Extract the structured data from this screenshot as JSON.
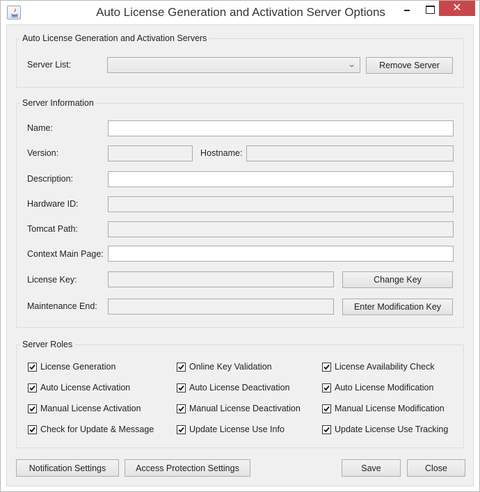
{
  "window": {
    "title": "Auto License Generation and Activation Server Options",
    "icon": "java-app-icon",
    "controls": {
      "minimize": "minimize-icon",
      "maximize": "maximize-icon",
      "close": "✕"
    }
  },
  "servers_group": {
    "legend": "Auto License Generation and Activation Servers",
    "server_list_label": "Server List:",
    "server_list_value": "",
    "remove_server_button": "Remove Server"
  },
  "server_info": {
    "legend": "Server Information",
    "name_label": "Name:",
    "name_value": "",
    "version_label": "Version:",
    "version_value": "",
    "hostname_label": "Hostname:",
    "hostname_value": "",
    "description_label": "Description:",
    "description_value": "",
    "hardware_id_label": "Hardware ID:",
    "hardware_id_value": "",
    "tomcat_path_label": "Tomcat Path:",
    "tomcat_path_value": "",
    "context_main_page_label": "Context Main Page:",
    "context_main_page_value": "",
    "license_key_label": "License Key:",
    "license_key_value": "",
    "change_key_button": "Change Key",
    "maintenance_end_label": "Maintenance End:",
    "maintenance_end_value": "",
    "enter_modification_key_button": "Enter Modification Key"
  },
  "server_roles": {
    "legend": "Server Roles",
    "roles": [
      {
        "label": "License Generation",
        "checked": true
      },
      {
        "label": "Online Key Validation",
        "checked": true
      },
      {
        "label": "License Availability Check",
        "checked": true
      },
      {
        "label": "Auto License Activation",
        "checked": true
      },
      {
        "label": "Auto License Deactivation",
        "checked": true
      },
      {
        "label": "Auto License Modification",
        "checked": true
      },
      {
        "label": "Manual License Activation",
        "checked": true
      },
      {
        "label": "Manual License Deactivation",
        "checked": true
      },
      {
        "label": "Manual License Modification",
        "checked": true
      },
      {
        "label": "Check for Update & Message",
        "checked": true
      },
      {
        "label": "Update License Use Info",
        "checked": true
      },
      {
        "label": "Update License Use Tracking",
        "checked": true
      }
    ]
  },
  "footer": {
    "notification_settings_button": "Notification Settings",
    "access_protection_settings_button": "Access Protection Settings",
    "save_button": "Save",
    "close_button": "Close"
  }
}
